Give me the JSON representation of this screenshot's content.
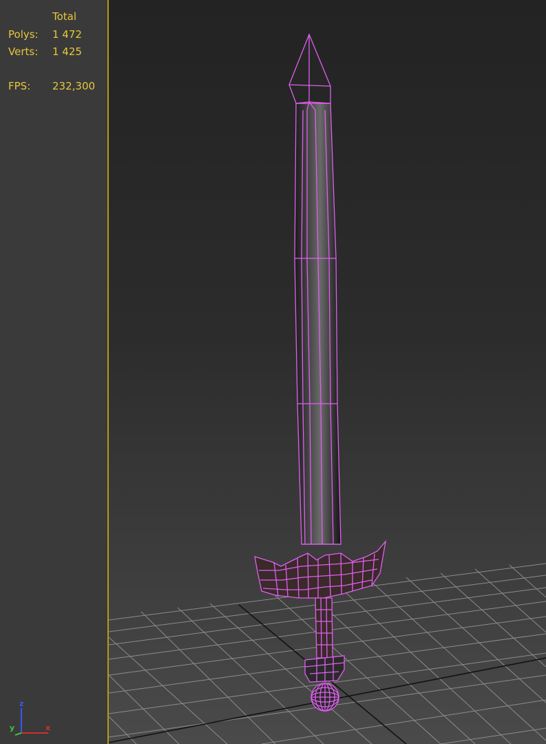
{
  "stats": {
    "header": "Total",
    "polys_label": "Polys:",
    "polys_value": "1 472",
    "verts_label": "Verts:",
    "verts_value": "1 425",
    "fps_label": "FPS:",
    "fps_value": "232,300"
  },
  "gizmo": {
    "z": "z",
    "y": "y",
    "x": "x"
  },
  "colors": {
    "stats_text": "#e7c83a",
    "divider": "#b59a1c",
    "wireframe": "#e060f0",
    "grid": "#9a9a9a",
    "grid_main_axis": "#111111",
    "axis_z": "#3a55ff",
    "axis_y": "#3ac43a",
    "axis_x": "#d03030"
  },
  "icons": [
    "axis-gizmo-icon"
  ]
}
